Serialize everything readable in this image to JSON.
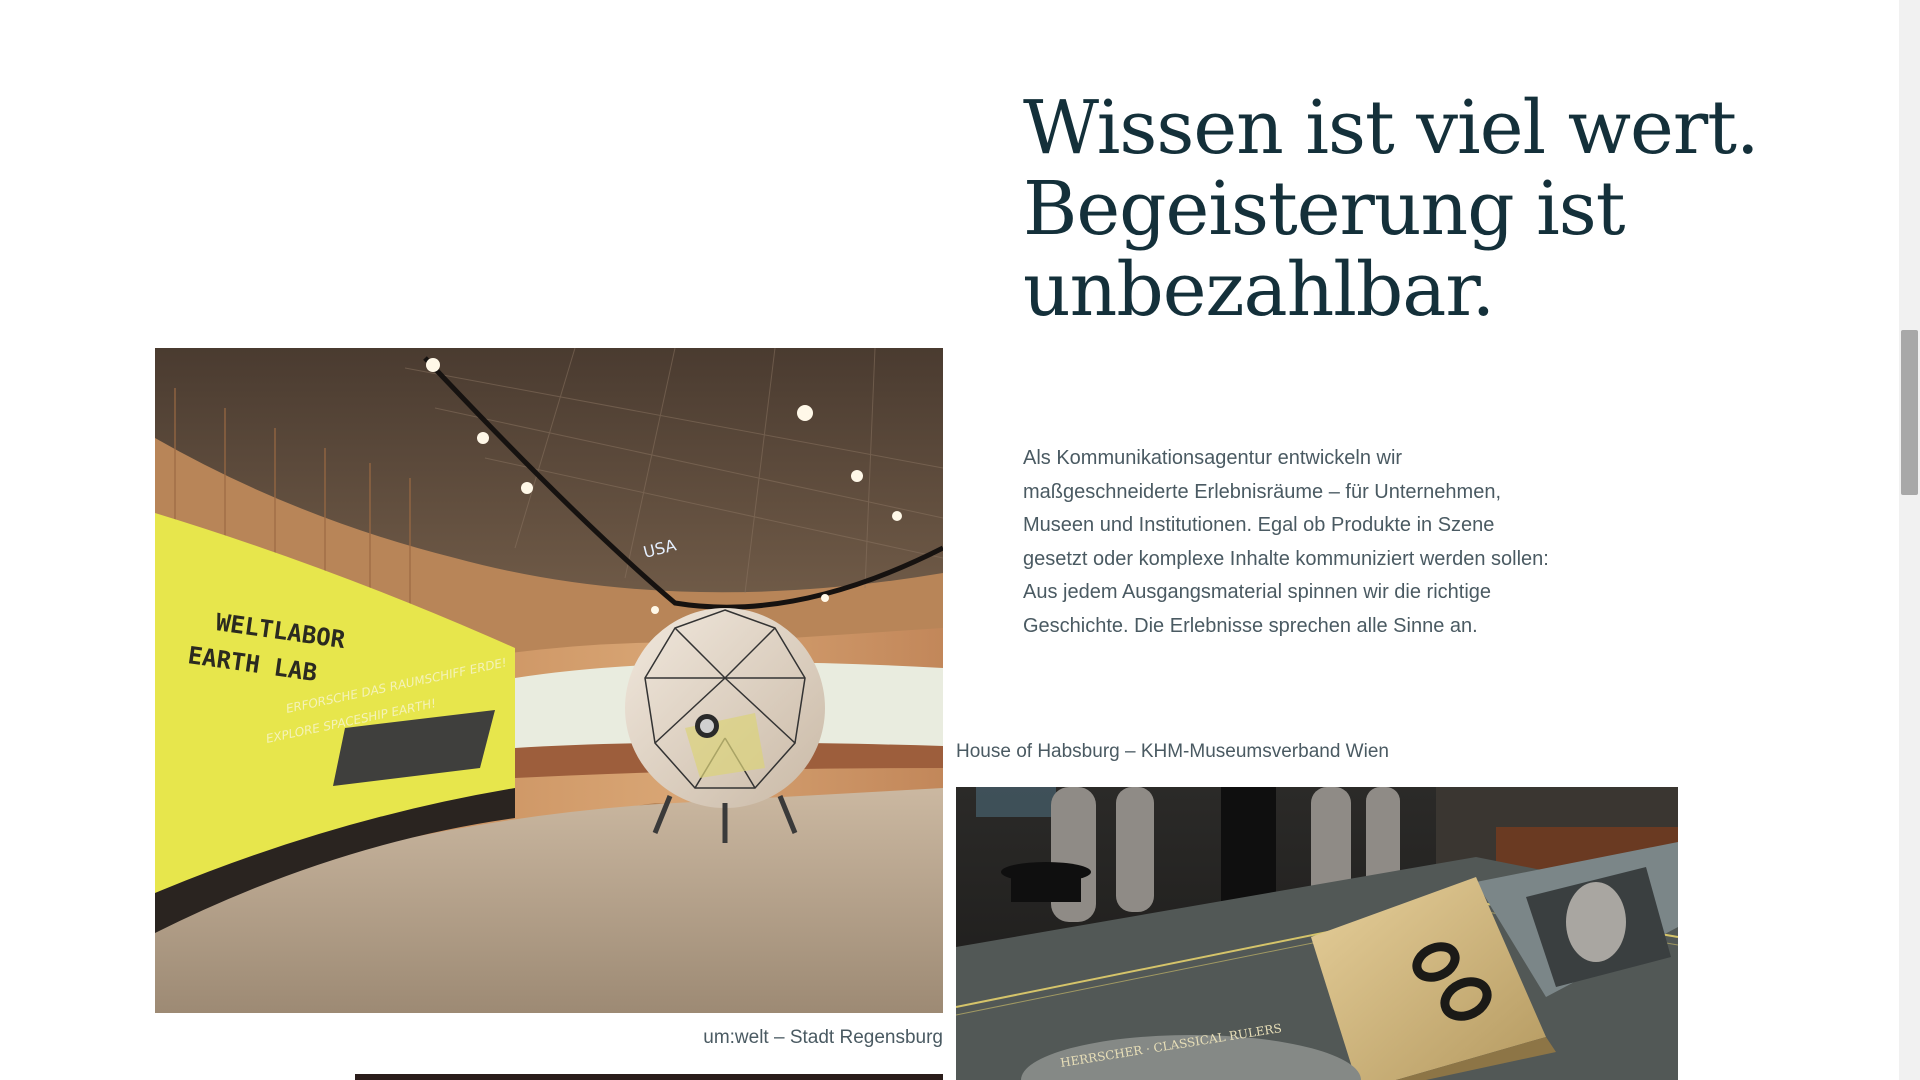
{
  "headline": {
    "line1": "Wissen ist viel wert.",
    "line2": "Begeisterung ist",
    "line3": "unbezahlbar."
  },
  "intro": {
    "text": "Als Kommunikationsagentur entwickeln wir maßgeschneiderte Erlebnisräume – für Unternehmen, Museen und Institutionen. Egal ob Produkte in Szene gesetzt oder komplexe Inhalte kommuniziert werden sollen: Aus jedem Ausgangsmaterial spinnen wir die richtige Geschichte. Die Erlebnisse sprechen alle Sinne an."
  },
  "projects": [
    {
      "caption": "um:welt – Stadt Regensburg",
      "image_text": {
        "wall_title_1": "WELTLABOR",
        "wall_title_2": "EARTH LAB",
        "wall_sub_1": "ERFORSCHE DAS RAUMSCHIFF ERDE!",
        "wall_sub_2": "EXPLORE SPACESHIP EARTH!",
        "ceiling": "USA"
      }
    },
    {
      "caption": "House of Habsburg – KHM-Museumsverband Wien",
      "image_text": {
        "panel": "HERRSCHER · CLASSICAL RULERS"
      }
    }
  ],
  "scrollbar": {
    "position_fraction": 0.31
  }
}
